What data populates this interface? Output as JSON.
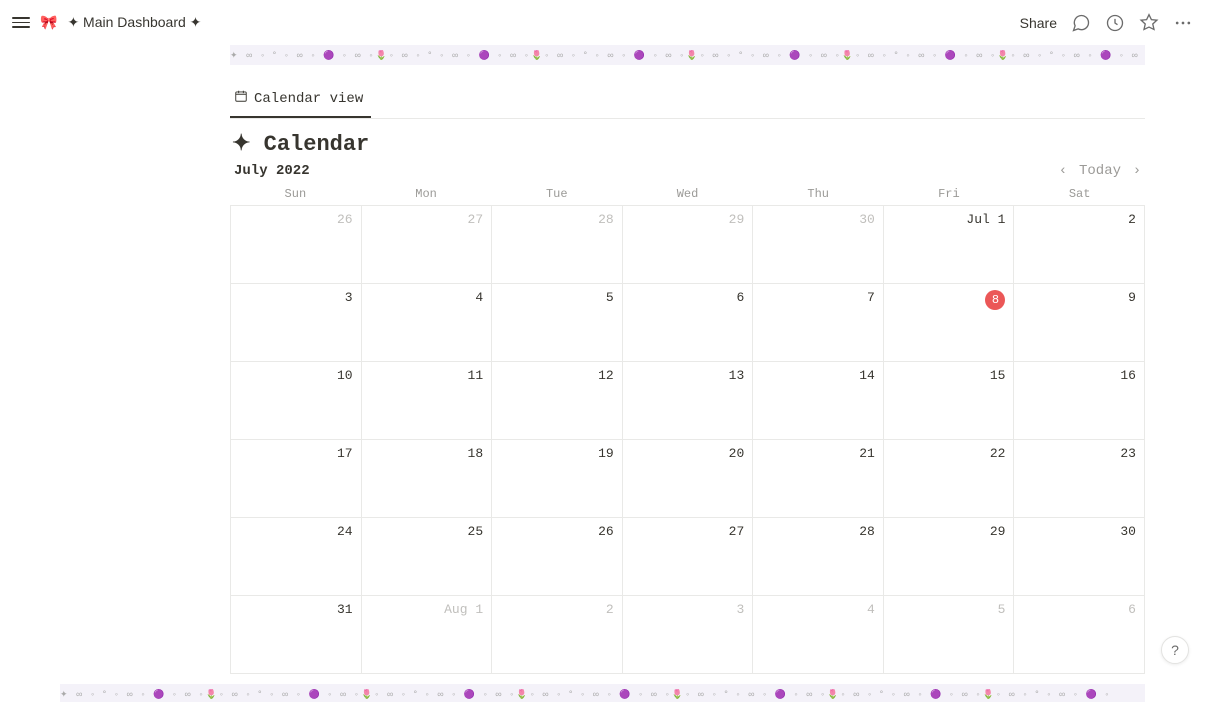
{
  "topbar": {
    "icon": "🎀",
    "title": "✦ Main Dashboard ✦",
    "share": "Share"
  },
  "banner_pattern": "✦ ∞ ◦ ° ◦ ∞ ◦ 🟣 ◦ ∞ ◦🌷◦ ∞ ◦ ° ◦ ∞ ◦ 🟣 ◦ ∞ ◦🌷◦ ∞ ◦ ° ◦ ∞ ◦ 🟣 ◦ ∞ ◦🌷◦ ∞ ◦ ° ◦ ∞ ◦ 🟣 ◦ ∞ ◦🌷◦ ∞ ◦ ° ◦ ∞ ◦ 🟣 ◦ ∞ ◦🌷◦ ∞ ◦ ° ◦ ∞ ◦ 🟣 ◦ ∞ ◦🌷◦ ∞ ◦ ° ◦ ∞ ◦ 🟣 ◦",
  "tab": {
    "label": "Calendar view"
  },
  "title": "✦ Calendar",
  "calendar": {
    "month": "July 2022",
    "today_label": "Today",
    "weekdays": [
      "Sun",
      "Mon",
      "Tue",
      "Wed",
      "Thu",
      "Fri",
      "Sat"
    ],
    "cells": [
      {
        "t": "26",
        "o": true
      },
      {
        "t": "27",
        "o": true
      },
      {
        "t": "28",
        "o": true
      },
      {
        "t": "29",
        "o": true
      },
      {
        "t": "30",
        "o": true
      },
      {
        "t": "Jul 1"
      },
      {
        "t": "2"
      },
      {
        "t": "3"
      },
      {
        "t": "4"
      },
      {
        "t": "5"
      },
      {
        "t": "6"
      },
      {
        "t": "7"
      },
      {
        "t": "8",
        "today": true
      },
      {
        "t": "9"
      },
      {
        "t": "10"
      },
      {
        "t": "11"
      },
      {
        "t": "12"
      },
      {
        "t": "13"
      },
      {
        "t": "14"
      },
      {
        "t": "15"
      },
      {
        "t": "16"
      },
      {
        "t": "17"
      },
      {
        "t": "18"
      },
      {
        "t": "19"
      },
      {
        "t": "20"
      },
      {
        "t": "21"
      },
      {
        "t": "22"
      },
      {
        "t": "23"
      },
      {
        "t": "24"
      },
      {
        "t": "25"
      },
      {
        "t": "26"
      },
      {
        "t": "27"
      },
      {
        "t": "28"
      },
      {
        "t": "29"
      },
      {
        "t": "30"
      },
      {
        "t": "31"
      },
      {
        "t": "Aug 1",
        "o": true
      },
      {
        "t": "2",
        "o": true
      },
      {
        "t": "3",
        "o": true
      },
      {
        "t": "4",
        "o": true
      },
      {
        "t": "5",
        "o": true
      },
      {
        "t": "6",
        "o": true
      }
    ]
  },
  "help": "?"
}
